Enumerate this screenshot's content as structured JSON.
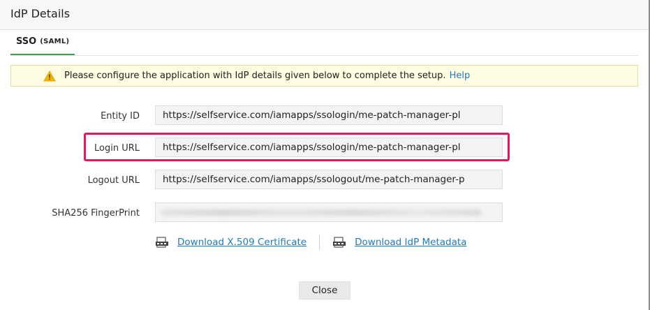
{
  "dialog": {
    "title": "IdP Details"
  },
  "tabs": [
    {
      "label": "SSO",
      "sub": "(SAML)"
    }
  ],
  "notice": {
    "text": "Please configure the application with IdP details given below to complete the setup.",
    "help_label": "Help",
    "icon": "warning-icon"
  },
  "fields": {
    "entity_id": {
      "label": "Entity ID",
      "value": "https://selfservice.com/iamapps/ssologin/me-patch-manager-pl"
    },
    "login_url": {
      "label": "Login URL",
      "value": "https://selfservice.com/iamapps/ssologin/me-patch-manager-pl"
    },
    "logout_url": {
      "label": "Logout URL",
      "value": "https://selfservice.com/iamapps/ssologout/me-patch-manager-p"
    },
    "fingerprint": {
      "label": "SHA256 FingerPrint",
      "value": ""
    }
  },
  "downloads": {
    "certificate_label": "Download X.509 Certificate",
    "metadata_label": "Download IdP Metadata"
  },
  "footer": {
    "close_label": "Close"
  },
  "colors": {
    "accent_tab": "#3aa14a",
    "link": "#1f7ac0",
    "highlight": "#e5175f",
    "notice_bg": "#fdfbe2"
  }
}
